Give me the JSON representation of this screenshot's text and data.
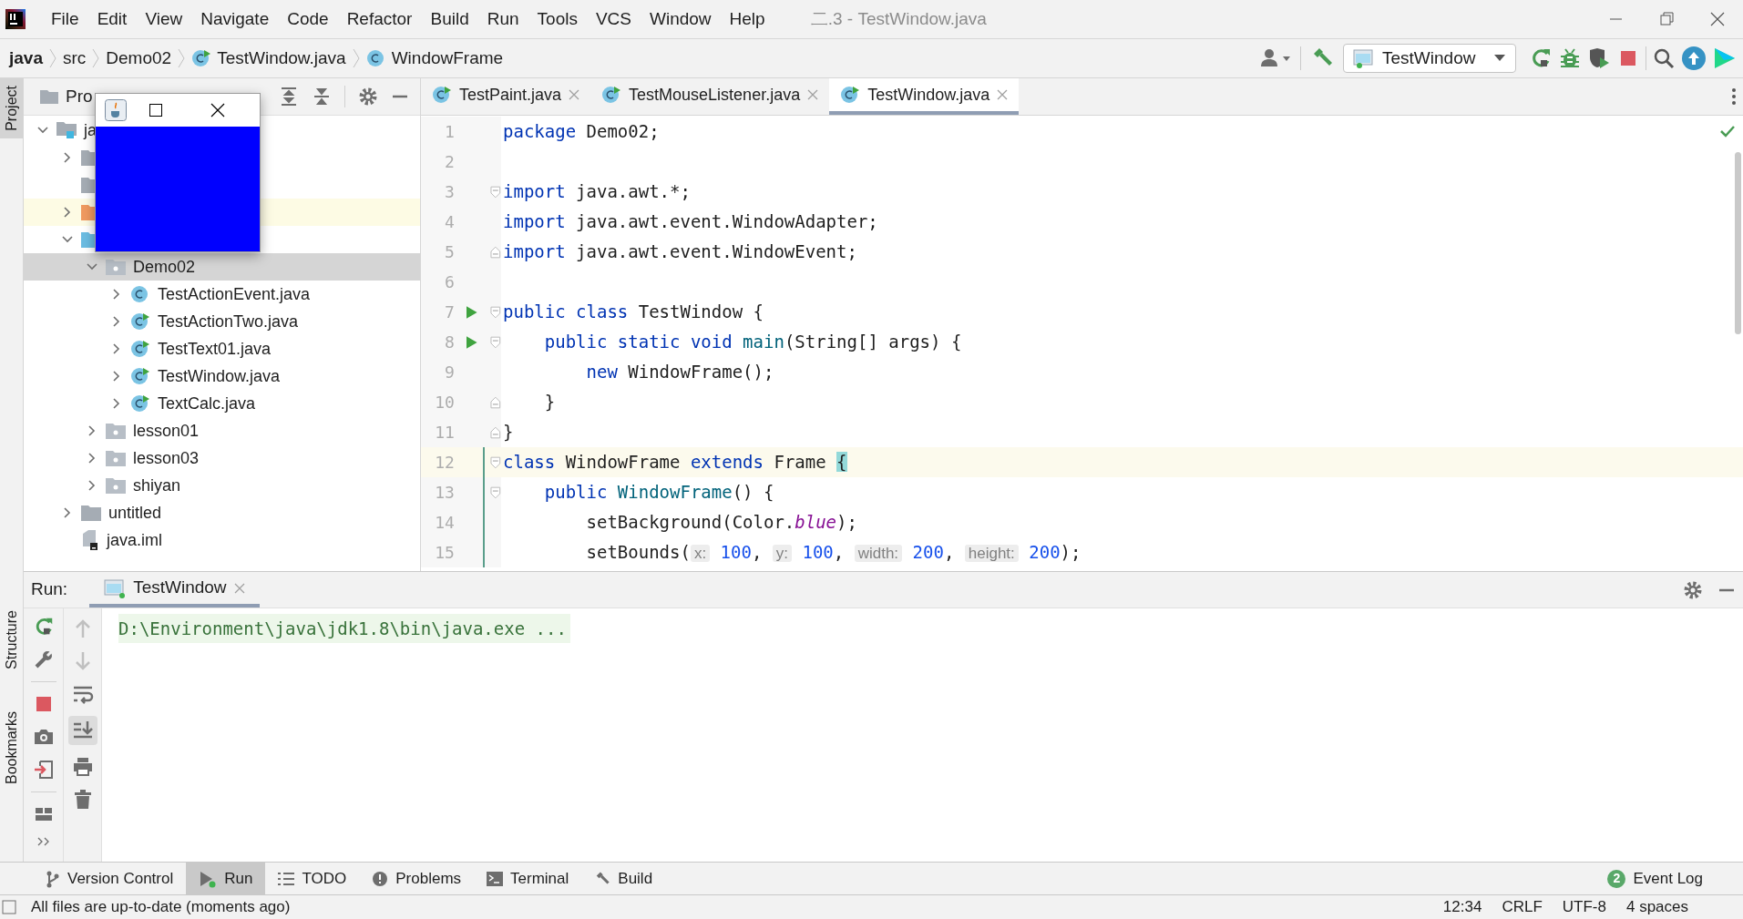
{
  "window": {
    "title": "二.3 - TestWindow.java"
  },
  "menu": [
    "File",
    "Edit",
    "View",
    "Navigate",
    "Code",
    "Refactor",
    "Build",
    "Run",
    "Tools",
    "VCS",
    "Window",
    "Help"
  ],
  "breadcrumbs": [
    {
      "label": "java",
      "kind": "module"
    },
    {
      "label": "src",
      "kind": "folder"
    },
    {
      "label": "Demo02",
      "kind": "package"
    },
    {
      "label": "TestWindow.java",
      "kind": "main-class"
    },
    {
      "label": "WindowFrame",
      "kind": "class"
    }
  ],
  "run_config": {
    "label": "TestWindow"
  },
  "left_stripe": [
    {
      "label": "Project",
      "selected": true
    },
    {
      "label": "Structure",
      "selected": false
    },
    {
      "label": "Bookmarks",
      "selected": false
    }
  ],
  "project_panel": {
    "title": "Pro",
    "tree": [
      {
        "label": "ja",
        "kind": "module",
        "expanded": true,
        "selected": false,
        "highlighted": false,
        "children": [
          {
            "kind": "folder",
            "expanded": false,
            "selected": false,
            "highlighted": false
          },
          {
            "kind": "folder",
            "selected": false,
            "highlighted": false
          },
          {
            "kind": "excluded-folder",
            "expanded": false,
            "selected": false,
            "highlighted": true
          },
          {
            "kind": "source-folder",
            "expanded": true,
            "selected": false,
            "highlighted": false,
            "children": [
              {
                "label": "Demo02",
                "kind": "package",
                "expanded": true,
                "selected": true,
                "highlighted": false,
                "children": [
                  {
                    "label": "TestActionEvent.java",
                    "kind": "class",
                    "expanded": false,
                    "selected": false,
                    "highlighted": false
                  },
                  {
                    "label": "TestActionTwo.java",
                    "kind": "main-class",
                    "expanded": false,
                    "selected": false,
                    "highlighted": false
                  },
                  {
                    "label": "TestText01.java",
                    "kind": "main-class",
                    "expanded": false,
                    "selected": false,
                    "highlighted": false
                  },
                  {
                    "label": "TestWindow.java",
                    "kind": "main-class",
                    "expanded": false,
                    "selected": false,
                    "highlighted": false
                  },
                  {
                    "label": "TextCalc.java",
                    "kind": "main-class",
                    "expanded": false,
                    "selected": false,
                    "highlighted": false
                  }
                ]
              },
              {
                "label": "lesson01",
                "kind": "package",
                "expanded": false,
                "selected": false,
                "highlighted": false
              },
              {
                "label": "lesson03",
                "kind": "package",
                "expanded": false,
                "selected": false,
                "highlighted": false
              },
              {
                "label": "shiyan",
                "kind": "package",
                "expanded": false,
                "selected": false,
                "highlighted": false
              }
            ]
          },
          {
            "label": "untitled",
            "kind": "folder",
            "expanded": false,
            "selected": false,
            "highlighted": false
          },
          {
            "label": "java.iml",
            "kind": "module-file",
            "selected": false,
            "highlighted": false
          }
        ]
      }
    ]
  },
  "editor_tabs": [
    {
      "label": "TestPaint.java",
      "selected": false
    },
    {
      "label": "TestMouseListener.java",
      "selected": false
    },
    {
      "label": "TestWindow.java",
      "selected": true
    }
  ],
  "code_lines": [
    {
      "number": "1",
      "run": false,
      "fold_start": false,
      "fold_end": false,
      "current": false,
      "modified": false,
      "tokens": [
        {
          "kind": "kw",
          "text": "package"
        },
        {
          "kind": "text",
          "text": " Demo02;"
        }
      ]
    },
    {
      "number": "2",
      "run": false,
      "fold_start": false,
      "fold_end": false,
      "current": false,
      "modified": false
    },
    {
      "number": "3",
      "run": false,
      "fold_start": true,
      "fold_end": false,
      "current": false,
      "modified": false,
      "tokens": [
        {
          "kind": "kw",
          "text": "import"
        },
        {
          "kind": "text",
          "text": " java.awt.*;"
        }
      ]
    },
    {
      "number": "4",
      "run": false,
      "fold_start": false,
      "fold_end": false,
      "current": false,
      "modified": false,
      "tokens": [
        {
          "kind": "kw",
          "text": "import"
        },
        {
          "kind": "text",
          "text": " java.awt.event.WindowAdapter;"
        }
      ]
    },
    {
      "number": "5",
      "run": false,
      "fold_start": false,
      "fold_end": true,
      "current": false,
      "modified": false,
      "tokens": [
        {
          "kind": "kw",
          "text": "import"
        },
        {
          "kind": "text",
          "text": " java.awt.event.WindowEvent;"
        }
      ]
    },
    {
      "number": "6",
      "run": false,
      "fold_start": false,
      "fold_end": false,
      "current": false,
      "modified": false
    },
    {
      "number": "7",
      "run": true,
      "fold_start": true,
      "fold_end": false,
      "current": false,
      "modified": false,
      "tokens": [
        {
          "kind": "kw",
          "text": "public class"
        },
        {
          "kind": "text",
          "text": " TestWindow {"
        }
      ]
    },
    {
      "number": "8",
      "run": true,
      "fold_start": true,
      "fold_end": false,
      "current": false,
      "modified": false,
      "tokens": [
        {
          "kind": "kw",
          "text": "    public static void"
        },
        {
          "kind": "fn",
          "text": " main"
        },
        {
          "kind": "text",
          "text": "(String[] args) {"
        }
      ]
    },
    {
      "number": "9",
      "run": false,
      "fold_start": false,
      "fold_end": false,
      "current": false,
      "modified": false,
      "tokens": [
        {
          "kind": "kw",
          "text": "        new"
        },
        {
          "kind": "text",
          "text": " WindowFrame();"
        }
      ]
    },
    {
      "number": "10",
      "run": false,
      "fold_start": false,
      "fold_end": true,
      "current": false,
      "modified": false,
      "tokens": [
        {
          "kind": "text",
          "text": "    }"
        }
      ]
    },
    {
      "number": "11",
      "run": false,
      "fold_start": false,
      "fold_end": true,
      "current": false,
      "modified": false,
      "tokens": [
        {
          "kind": "text",
          "text": "}"
        }
      ]
    },
    {
      "number": "12",
      "run": false,
      "fold_start": true,
      "fold_end": false,
      "current": true,
      "modified": true,
      "tokens": [
        {
          "kind": "kw",
          "text": "class"
        },
        {
          "kind": "text",
          "text": " WindowFrame "
        },
        {
          "kind": "kw",
          "text": "extends"
        },
        {
          "kind": "text",
          "text": " Frame "
        },
        {
          "kind": "brace",
          "text": "{"
        }
      ]
    },
    {
      "number": "13",
      "run": false,
      "fold_start": true,
      "fold_end": false,
      "current": false,
      "modified": true,
      "tokens": [
        {
          "kind": "kw",
          "text": "    public"
        },
        {
          "kind": "fn",
          "text": " WindowFrame"
        },
        {
          "kind": "text",
          "text": "() {"
        }
      ]
    },
    {
      "number": "14",
      "run": false,
      "fold_start": false,
      "fold_end": false,
      "current": false,
      "modified": true,
      "tokens": [
        {
          "kind": "text",
          "text": "        setBackground(Color."
        },
        {
          "kind": "field",
          "text": "blue"
        },
        {
          "kind": "text",
          "text": ");"
        }
      ]
    },
    {
      "number": "15",
      "run": false,
      "fold_start": false,
      "fold_end": false,
      "current": false,
      "modified": true,
      "tokens": [
        {
          "kind": "text",
          "text": "        setBounds("
        },
        {
          "kind": "hint",
          "text": "x:"
        },
        {
          "kind": "num",
          "text": " 100"
        },
        {
          "kind": "text",
          "text": ", "
        },
        {
          "kind": "hint",
          "text": "y:"
        },
        {
          "kind": "num",
          "text": " 100"
        },
        {
          "kind": "text",
          "text": ", "
        },
        {
          "kind": "hint",
          "text": "width:"
        },
        {
          "kind": "num",
          "text": " 200"
        },
        {
          "kind": "text",
          "text": ", "
        },
        {
          "kind": "hint",
          "text": "height:"
        },
        {
          "kind": "num",
          "text": " 200"
        },
        {
          "kind": "text",
          "text": ");"
        }
      ]
    }
  ],
  "run_panel": {
    "label": "Run:",
    "tabs": [
      {
        "label": "TestWindow",
        "selected": true
      }
    ],
    "console": [
      "D:\\Environment\\java\\jdk1.8\\bin\\java.exe ..."
    ]
  },
  "tool_windows": [
    {
      "label": "Version Control",
      "kind": "vcs",
      "selected": false
    },
    {
      "label": "Run",
      "kind": "run",
      "selected": true
    },
    {
      "label": "TODO",
      "kind": "todo",
      "selected": false
    },
    {
      "label": "Problems",
      "kind": "problems",
      "selected": false
    },
    {
      "label": "Terminal",
      "kind": "terminal",
      "selected": false
    },
    {
      "label": "Build",
      "kind": "build",
      "selected": false
    }
  ],
  "event_log": {
    "label": "Event Log",
    "badge": "2"
  },
  "status_bar": {
    "message": "All files are up-to-date (moments ago)",
    "items": [
      "12:34",
      "CRLF",
      "UTF-8",
      "4 spaces"
    ]
  }
}
